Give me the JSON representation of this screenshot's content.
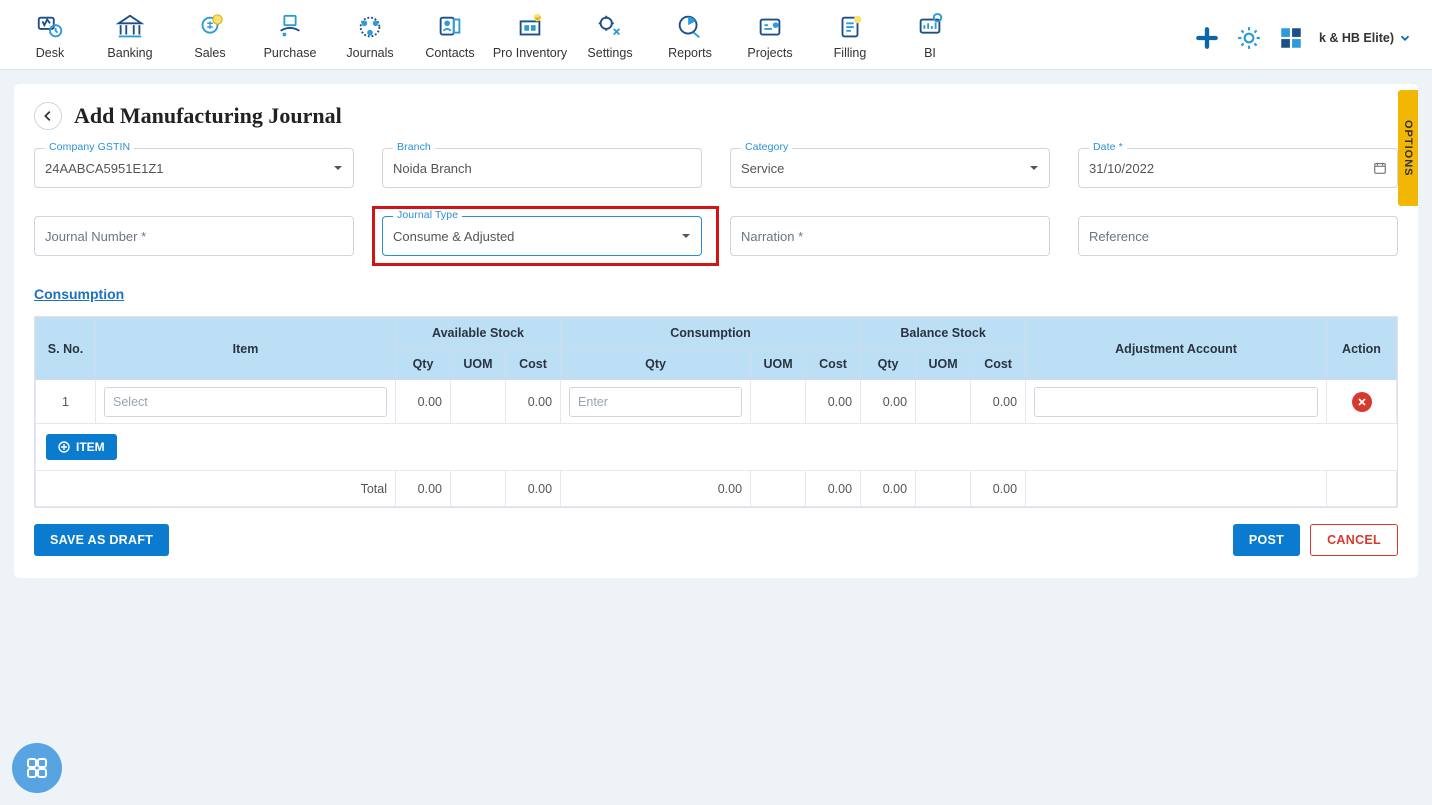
{
  "nav": {
    "items": [
      {
        "label": "Desk"
      },
      {
        "label": "Banking"
      },
      {
        "label": "Sales"
      },
      {
        "label": "Purchase"
      },
      {
        "label": "Journals"
      },
      {
        "label": "Contacts"
      },
      {
        "label": "Pro Inventory"
      },
      {
        "label": "Settings"
      },
      {
        "label": "Reports"
      },
      {
        "label": "Projects"
      },
      {
        "label": "Filling"
      },
      {
        "label": "BI"
      }
    ],
    "org_name": "k & HB Elite)"
  },
  "page_title": "Add Manufacturing Journal",
  "options_tab": "OPTIONS",
  "fields": {
    "gstin": {
      "label": "Company GSTIN",
      "value": "24AABCA5951E1Z1"
    },
    "branch": {
      "label": "Branch",
      "value": "Noida Branch"
    },
    "category": {
      "label": "Category",
      "value": "Service"
    },
    "date": {
      "label": "Date *",
      "value": "31/10/2022"
    },
    "journal_no": {
      "placeholder": "Journal Number *"
    },
    "journal_type": {
      "label": "Journal Type",
      "value": "Consume & Adjusted"
    },
    "narration": {
      "placeholder": "Narration *"
    },
    "reference": {
      "placeholder": "Reference"
    }
  },
  "section_link": "Consumption",
  "table": {
    "headers": {
      "sno": "S. No.",
      "item": "Item",
      "avail": "Available Stock",
      "cons": "Consumption",
      "bal": "Balance Stock",
      "adj": "Adjustment Account",
      "action": "Action",
      "qty": "Qty",
      "uom": "UOM",
      "cost": "Cost"
    },
    "row": {
      "sno": "1",
      "item_placeholder": "Select",
      "avail_qty": "0.00",
      "avail_cost": "0.00",
      "cons_qty_placeholder": "Enter",
      "cons_cost": "0.00",
      "bal_qty": "0.00",
      "bal_cost": "0.00"
    },
    "add_item": "ITEM",
    "totals": {
      "label": "Total",
      "avail_qty": "0.00",
      "avail_cost": "0.00",
      "cons_qty": "0.00",
      "cons_cost": "0.00",
      "bal_qty": "0.00",
      "bal_cost": "0.00"
    }
  },
  "buttons": {
    "save_draft": "SAVE AS DRAFT",
    "post": "POST",
    "cancel": "CANCEL"
  }
}
